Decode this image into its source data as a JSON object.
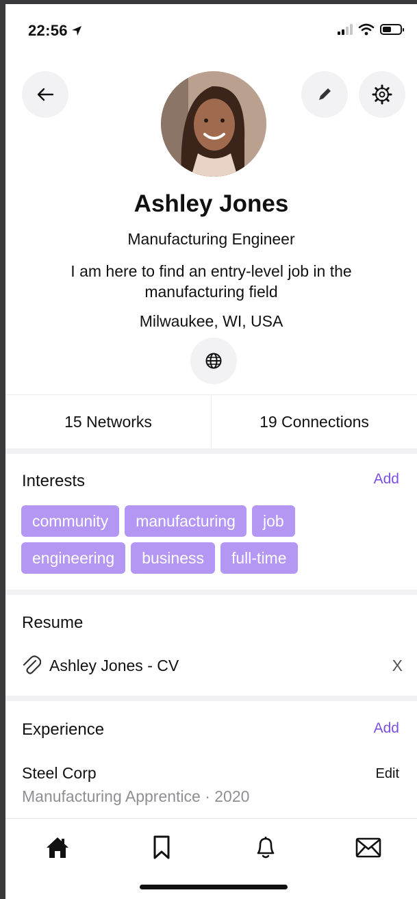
{
  "status_bar": {
    "time": "22:56"
  },
  "profile": {
    "name": "Ashley Jones",
    "title": "Manufacturing Engineer",
    "bio": "I am here to find an entry-level job in the manufacturing field",
    "location": "Milwaukee, WI, USA"
  },
  "stats": {
    "networks": "15 Networks",
    "connections": "19 Connections"
  },
  "interests": {
    "title": "Interests",
    "add_label": "Add",
    "tags_row1": [
      "community",
      "manufacturing",
      "job"
    ],
    "tags_row2": [
      "engineering",
      "business",
      "full-time"
    ]
  },
  "resume": {
    "title": "Resume",
    "file": "Ashley Jones - CV",
    "remove_label": "X"
  },
  "experience": {
    "title": "Experience",
    "add_label": "Add",
    "company": "Steel Corp",
    "role_line": "Manufacturing Apprentice · 2020",
    "edit_label": "Edit"
  },
  "colors": {
    "accent": "#7b4fe0",
    "tag_bg": "#b497f3"
  },
  "icons": [
    "back-arrow-icon",
    "pencil-icon",
    "settings-icon",
    "globe-icon",
    "paperclip-icon",
    "home-icon",
    "bookmark-icon",
    "bell-icon",
    "mail-icon"
  ]
}
